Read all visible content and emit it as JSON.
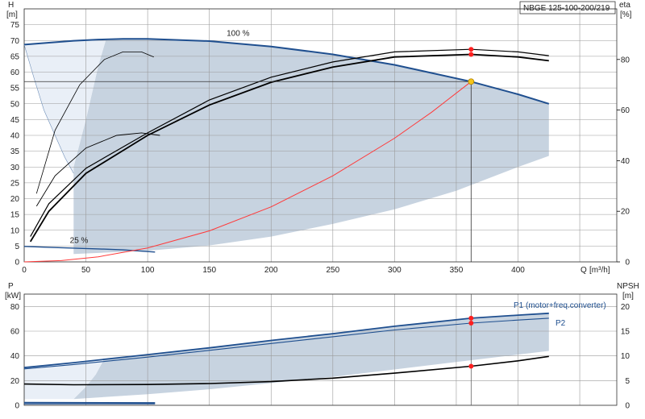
{
  "chart_data": [
    {
      "type": "line",
      "title": "NBGE 125-100-200/219",
      "ylabel": "H",
      "yunit": "[m]",
      "y2label": "eta",
      "y2unit": "[%]",
      "xlabel": "Q",
      "xunit": "[m³/h]",
      "xlim": [
        0,
        480
      ],
      "ylim": [
        0,
        80
      ],
      "y2lim": [
        0,
        100
      ],
      "x_ticks": [
        0,
        50,
        100,
        150,
        200,
        250,
        300,
        350,
        400
      ],
      "x_tick_labels": [
        "0",
        "50",
        "100",
        "150",
        "200",
        "250",
        "300",
        "350",
        "400"
      ],
      "y_ticks": [
        0,
        5,
        10,
        15,
        20,
        25,
        30,
        35,
        40,
        45,
        50,
        55,
        60,
        65,
        70,
        75
      ],
      "y_tick_labels": [
        "0",
        "5",
        "10",
        "15",
        "20",
        "25",
        "30",
        "35",
        "40",
        "45",
        "50",
        "55",
        "60",
        "65",
        "70",
        "75"
      ],
      "y2_ticks": [
        0,
        20,
        40,
        60,
        80
      ],
      "y2_tick_labels": [
        "0",
        "20",
        "40",
        "60",
        "80"
      ],
      "annotations": [
        {
          "text": "100 %",
          "x": 164,
          "y": 71.5
        },
        {
          "text": "25 %",
          "x": 37,
          "y": 6
        }
      ],
      "colors": {
        "curve": "#1f4f8f",
        "system": "#ff3a3a",
        "efficiency": "#000000",
        "area": "#c7d3e0",
        "area_light": "#e9eff7",
        "duty_point": "#f5c518",
        "eta_point": "#ff2020"
      },
      "series": [
        {
          "role": "max-curve",
          "values": [
            [
              0,
              68.7
            ],
            [
              20,
              69.3
            ],
            [
              40,
              69.9
            ],
            [
              60,
              70.3
            ],
            [
              80,
              70.5
            ],
            [
              100,
              70.5
            ],
            [
              150,
              69.8
            ],
            [
              200,
              68.1
            ],
            [
              250,
              65.6
            ],
            [
              300,
              62.3
            ],
            [
              362,
              57
            ],
            [
              400,
              53
            ],
            [
              425,
              50
            ]
          ]
        },
        {
          "role": "min-curve",
          "values": [
            [
              0,
              4.9
            ],
            [
              20,
              4.6
            ],
            [
              60,
              4.1
            ],
            [
              80,
              3.8
            ],
            [
              106,
              3.1
            ]
          ]
        },
        {
          "role": "system-curve",
          "values": [
            [
              0,
              0
            ],
            [
              30,
              0.4
            ],
            [
              60,
              1.6
            ],
            [
              100,
              4.4
            ],
            [
              150,
              9.8
            ],
            [
              200,
              17.4
            ],
            [
              250,
              27.2
            ],
            [
              300,
              39.1
            ],
            [
              330,
              47.3
            ],
            [
              362,
              57
            ]
          ]
        },
        {
          "role": "area-lower",
          "values": [
            [
              40,
              2.5
            ],
            [
              100,
              3.5
            ],
            [
              150,
              5.2
            ],
            [
              200,
              8
            ],
            [
              250,
              12
            ],
            [
              300,
              16.6
            ],
            [
              350,
              22.5
            ],
            [
              400,
              30
            ],
            [
              425,
              33.5
            ]
          ]
        },
        {
          "role": "area-left",
          "values": [
            [
              40,
              2.5
            ],
            [
              40,
              30
            ],
            [
              50,
              45
            ],
            [
              60,
              62
            ],
            [
              66,
              70
            ]
          ]
        },
        {
          "role": "light-left",
          "values": [
            [
              0,
              68.7
            ],
            [
              8,
              58
            ],
            [
              16,
              48
            ],
            [
              25,
              40
            ],
            [
              33,
              33
            ],
            [
              40,
              28
            ]
          ]
        },
        {
          "role": "eta-1",
          "values": [
            [
              5,
              8
            ],
            [
              20,
              20
            ],
            [
              50,
              35
            ],
            [
              100,
              50
            ],
            [
              150,
              62
            ],
            [
              200,
              71
            ],
            [
              250,
              77
            ],
            [
              300,
              81
            ],
            [
              362,
              82
            ],
            [
              400,
              81
            ],
            [
              425,
              79.5
            ]
          ]
        },
        {
          "role": "eta-2",
          "values": [
            [
              5,
              10
            ],
            [
              20,
              23
            ],
            [
              50,
              37
            ],
            [
              100,
              51
            ],
            [
              150,
              64
            ],
            [
              200,
              73
            ],
            [
              250,
              79
            ],
            [
              300,
              83
            ],
            [
              362,
              84
            ],
            [
              400,
              83
            ],
            [
              425,
              81.5
            ]
          ]
        },
        {
          "role": "eta-3",
          "values": [
            [
              10,
              22
            ],
            [
              25,
              34
            ],
            [
              50,
              45
            ],
            [
              75,
              50
            ],
            [
              95,
              51
            ],
            [
              110,
              50
            ]
          ]
        },
        {
          "role": "eta-4",
          "values": [
            [
              10,
              27
            ],
            [
              25,
              52
            ],
            [
              45,
              70
            ],
            [
              65,
              80
            ],
            [
              80,
              83
            ],
            [
              95,
              83
            ],
            [
              105,
              81
            ]
          ]
        }
      ],
      "duty_point": {
        "x": 362,
        "y": 57
      },
      "eta_points": [
        [
          362,
          82
        ],
        [
          362,
          84
        ]
      ]
    },
    {
      "type": "line",
      "ylabel": "P",
      "yunit": "[kW]",
      "y2label": "NPSH",
      "y2unit": "[m]",
      "xlim": [
        0,
        480
      ],
      "ylim": [
        0,
        90
      ],
      "y2lim": [
        0,
        22.5
      ],
      "y_ticks": [
        0,
        20,
        40,
        60,
        80
      ],
      "y_tick_labels": [
        "0",
        "20",
        "40",
        "60",
        "80"
      ],
      "y2_ticks": [
        0,
        5,
        10,
        15,
        20
      ],
      "y2_tick_labels": [
        "0",
        "5",
        "10",
        "15",
        "20"
      ],
      "series": [
        {
          "name": "P1 (motor+freq.converter)",
          "values": [
            [
              0,
              30.5
            ],
            [
              40,
              34.5
            ],
            [
              100,
              41
            ],
            [
              150,
              46.5
            ],
            [
              200,
              52.5
            ],
            [
              250,
              58
            ],
            [
              300,
              64
            ],
            [
              362,
              70.5
            ],
            [
              400,
              73
            ],
            [
              425,
              74.5
            ]
          ]
        },
        {
          "name": "P2",
          "values": [
            [
              0,
              29.5
            ],
            [
              40,
              33
            ],
            [
              100,
              39
            ],
            [
              150,
              44.5
            ],
            [
              200,
              50
            ],
            [
              250,
              55.5
            ],
            [
              300,
              61
            ],
            [
              362,
              66.5
            ],
            [
              400,
              69
            ],
            [
              425,
              70.5
            ]
          ]
        },
        {
          "role": "npsh",
          "values": [
            [
              0,
              4.3
            ],
            [
              40,
              4.15
            ],
            [
              100,
              4.2
            ],
            [
              150,
              4.4
            ],
            [
              200,
              4.8
            ],
            [
              250,
              5.5
            ],
            [
              300,
              6.5
            ],
            [
              362,
              7.9
            ],
            [
              400,
              9
            ],
            [
              425,
              9.9
            ]
          ]
        },
        {
          "role": "min-power-1",
          "values": [
            [
              0,
              1.2
            ],
            [
              106,
              1.3
            ]
          ]
        },
        {
          "role": "min-power-2",
          "values": [
            [
              0,
              2.3
            ],
            [
              106,
              2.1
            ]
          ]
        }
      ],
      "area": [
        [
          40,
          5
        ],
        [
          100,
          9
        ],
        [
          150,
          13
        ],
        [
          200,
          18
        ],
        [
          250,
          23
        ],
        [
          300,
          29
        ],
        [
          350,
          35
        ],
        [
          425,
          44
        ]
      ],
      "area_left": [
        [
          40,
          5
        ],
        [
          50,
          15
        ],
        [
          58,
          25
        ],
        [
          64,
          36
        ]
      ],
      "points": [
        [
          362,
          70.5
        ],
        [
          362,
          66.5
        ]
      ],
      "npsh_point": [
        362,
        7.9
      ]
    }
  ]
}
